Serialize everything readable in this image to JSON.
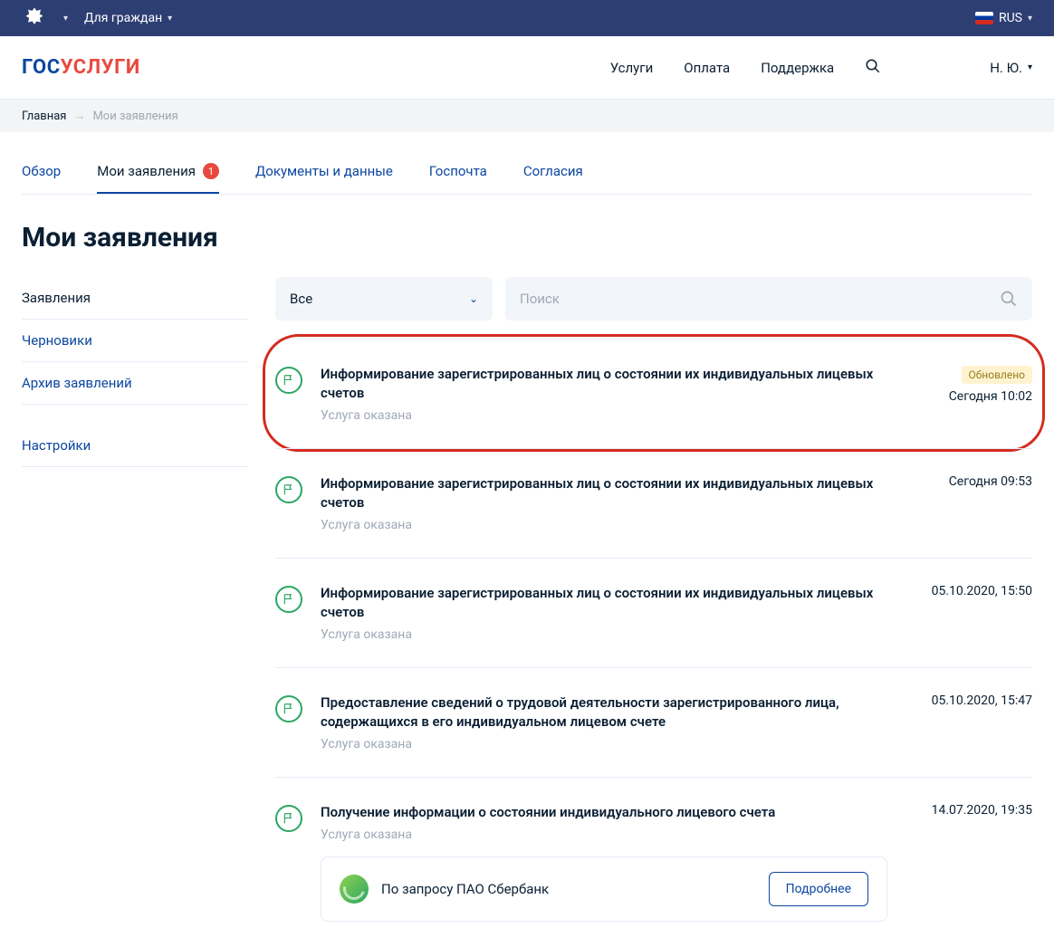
{
  "topbar": {
    "audience": "Для граждан",
    "lang": "RUS"
  },
  "nav": {
    "services": "Услуги",
    "payment": "Оплата",
    "support": "Поддержка"
  },
  "user": {
    "short": "Н. Ю."
  },
  "breadcrumb": {
    "home": "Главная",
    "current": "Мои заявления"
  },
  "tabs": {
    "overview": "Обзор",
    "apps": "Мои заявления",
    "apps_badge": "1",
    "docs": "Документы и данные",
    "mail": "Госпочта",
    "consent": "Согласия"
  },
  "page_title": "Мои заявления",
  "sidebar": {
    "apps": "Заявления",
    "drafts": "Черновики",
    "archive": "Архив заявлений",
    "settings": "Настройки"
  },
  "filter": {
    "select_label": "Все",
    "search_placeholder": "Поиск"
  },
  "badge_updated": "Обновлено",
  "items": [
    {
      "title": "Информирование зарегистрированных лиц о состоянии их индивидуальных лицевых счетов",
      "status": "Услуга оказана",
      "time": "Сегодня 10:02",
      "updated": true,
      "highlight": true
    },
    {
      "title": "Информирование зарегистрированных лиц о состоянии их индивидуальных лицевых счетов",
      "status": "Услуга оказана",
      "time": "Сегодня 09:53"
    },
    {
      "title": "Информирование зарегистрированных лиц о состоянии их индивидуальных лицевых счетов",
      "status": "Услуга оказана",
      "time": "05.10.2020, 15:50"
    },
    {
      "title": "Предоставление сведений о трудовой деятельности зарегистрированного лица, содержащихся в его индивидуальном лицевом счете",
      "status": "Услуга оказана",
      "time": "05.10.2020, 15:47"
    },
    {
      "title": "Получение информации о состоянии индивидуального лицевого счета",
      "status": "Услуга оказана",
      "time": "14.07.2020, 19:35",
      "request": "По запросу ПАО Сбербанк",
      "more": "Подробнее"
    }
  ]
}
